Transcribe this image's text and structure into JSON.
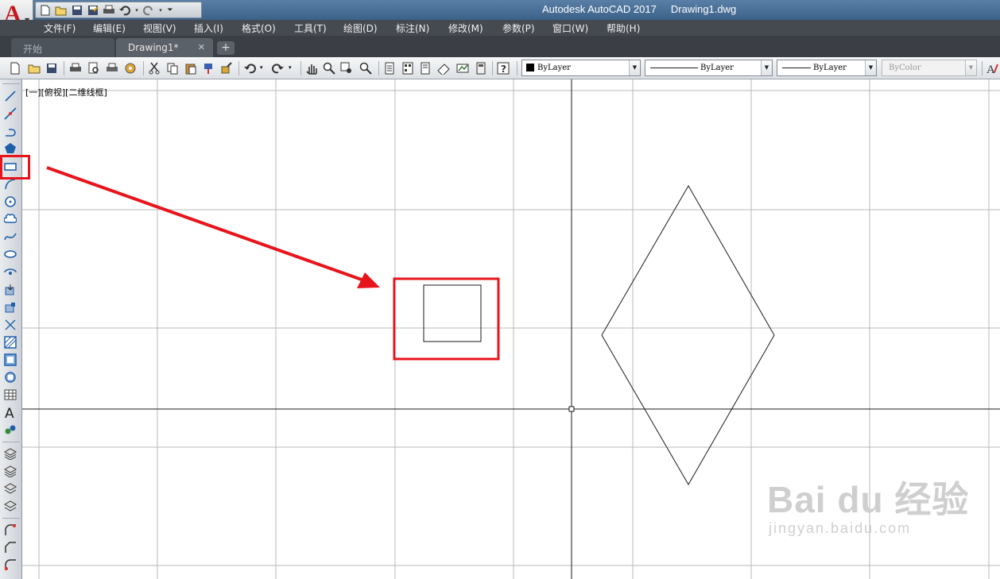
{
  "app": {
    "title": "Autodesk AutoCAD 2017     Drawing1.dwg",
    "logo_letter": "A"
  },
  "menu": [
    "文件(F)",
    "编辑(E)",
    "视图(V)",
    "插入(I)",
    "格式(O)",
    "工具(T)",
    "绘图(D)",
    "标注(N)",
    "修改(M)",
    "参数(P)",
    "窗口(W)",
    "帮助(H)"
  ],
  "tabs": {
    "start": "开始",
    "drawing": "Drawing1*",
    "close_glyph": "✕",
    "add_glyph": "+"
  },
  "properties": {
    "color_value": "ByLayer",
    "linetype_value": "ByLayer",
    "lineweight_value": "ByLayer",
    "plotstyle_value": "ByColor"
  },
  "viewport": {
    "label": "[一][俯视][二维线框]"
  },
  "watermark": {
    "brand": "Bai du 经验",
    "url": "jingyan.baidu.com"
  },
  "colors": {
    "highlight": "#e8141c",
    "menubar": "#454a51",
    "grid": "#b9b9b9"
  }
}
